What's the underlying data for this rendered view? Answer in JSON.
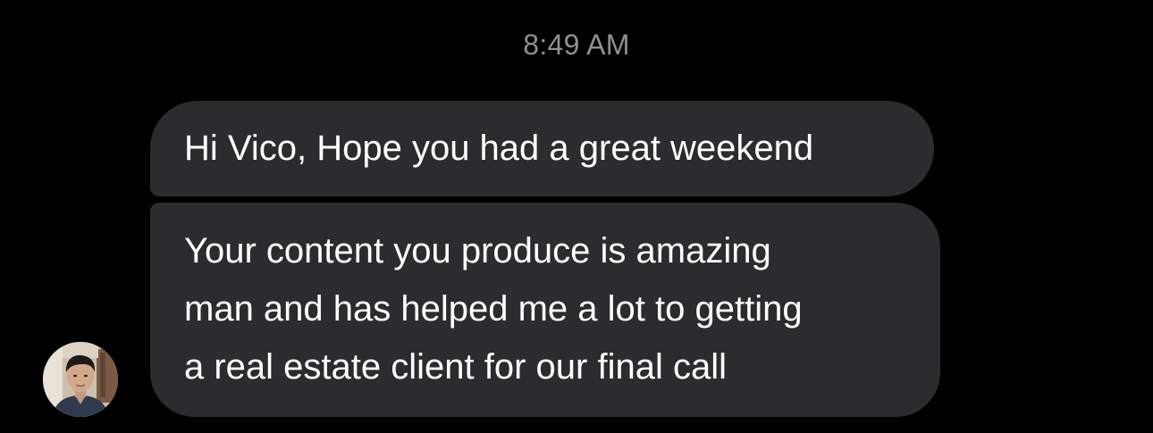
{
  "timestamp": "8:49 AM",
  "messages": [
    {
      "sender": "other",
      "lines": [
        "Hi Vico, Hope you had a great weekend"
      ]
    },
    {
      "sender": "other",
      "lines": [
        "Your content you produce is amazing",
        "man and has helped me a lot to getting",
        "a real estate client for our final call"
      ]
    }
  ],
  "avatar": {
    "icon": "user-avatar-photo"
  },
  "colors": {
    "background": "#000000",
    "bubble": "#2c2c2e",
    "timestamp": "#8e8e93",
    "text": "#ffffff"
  }
}
